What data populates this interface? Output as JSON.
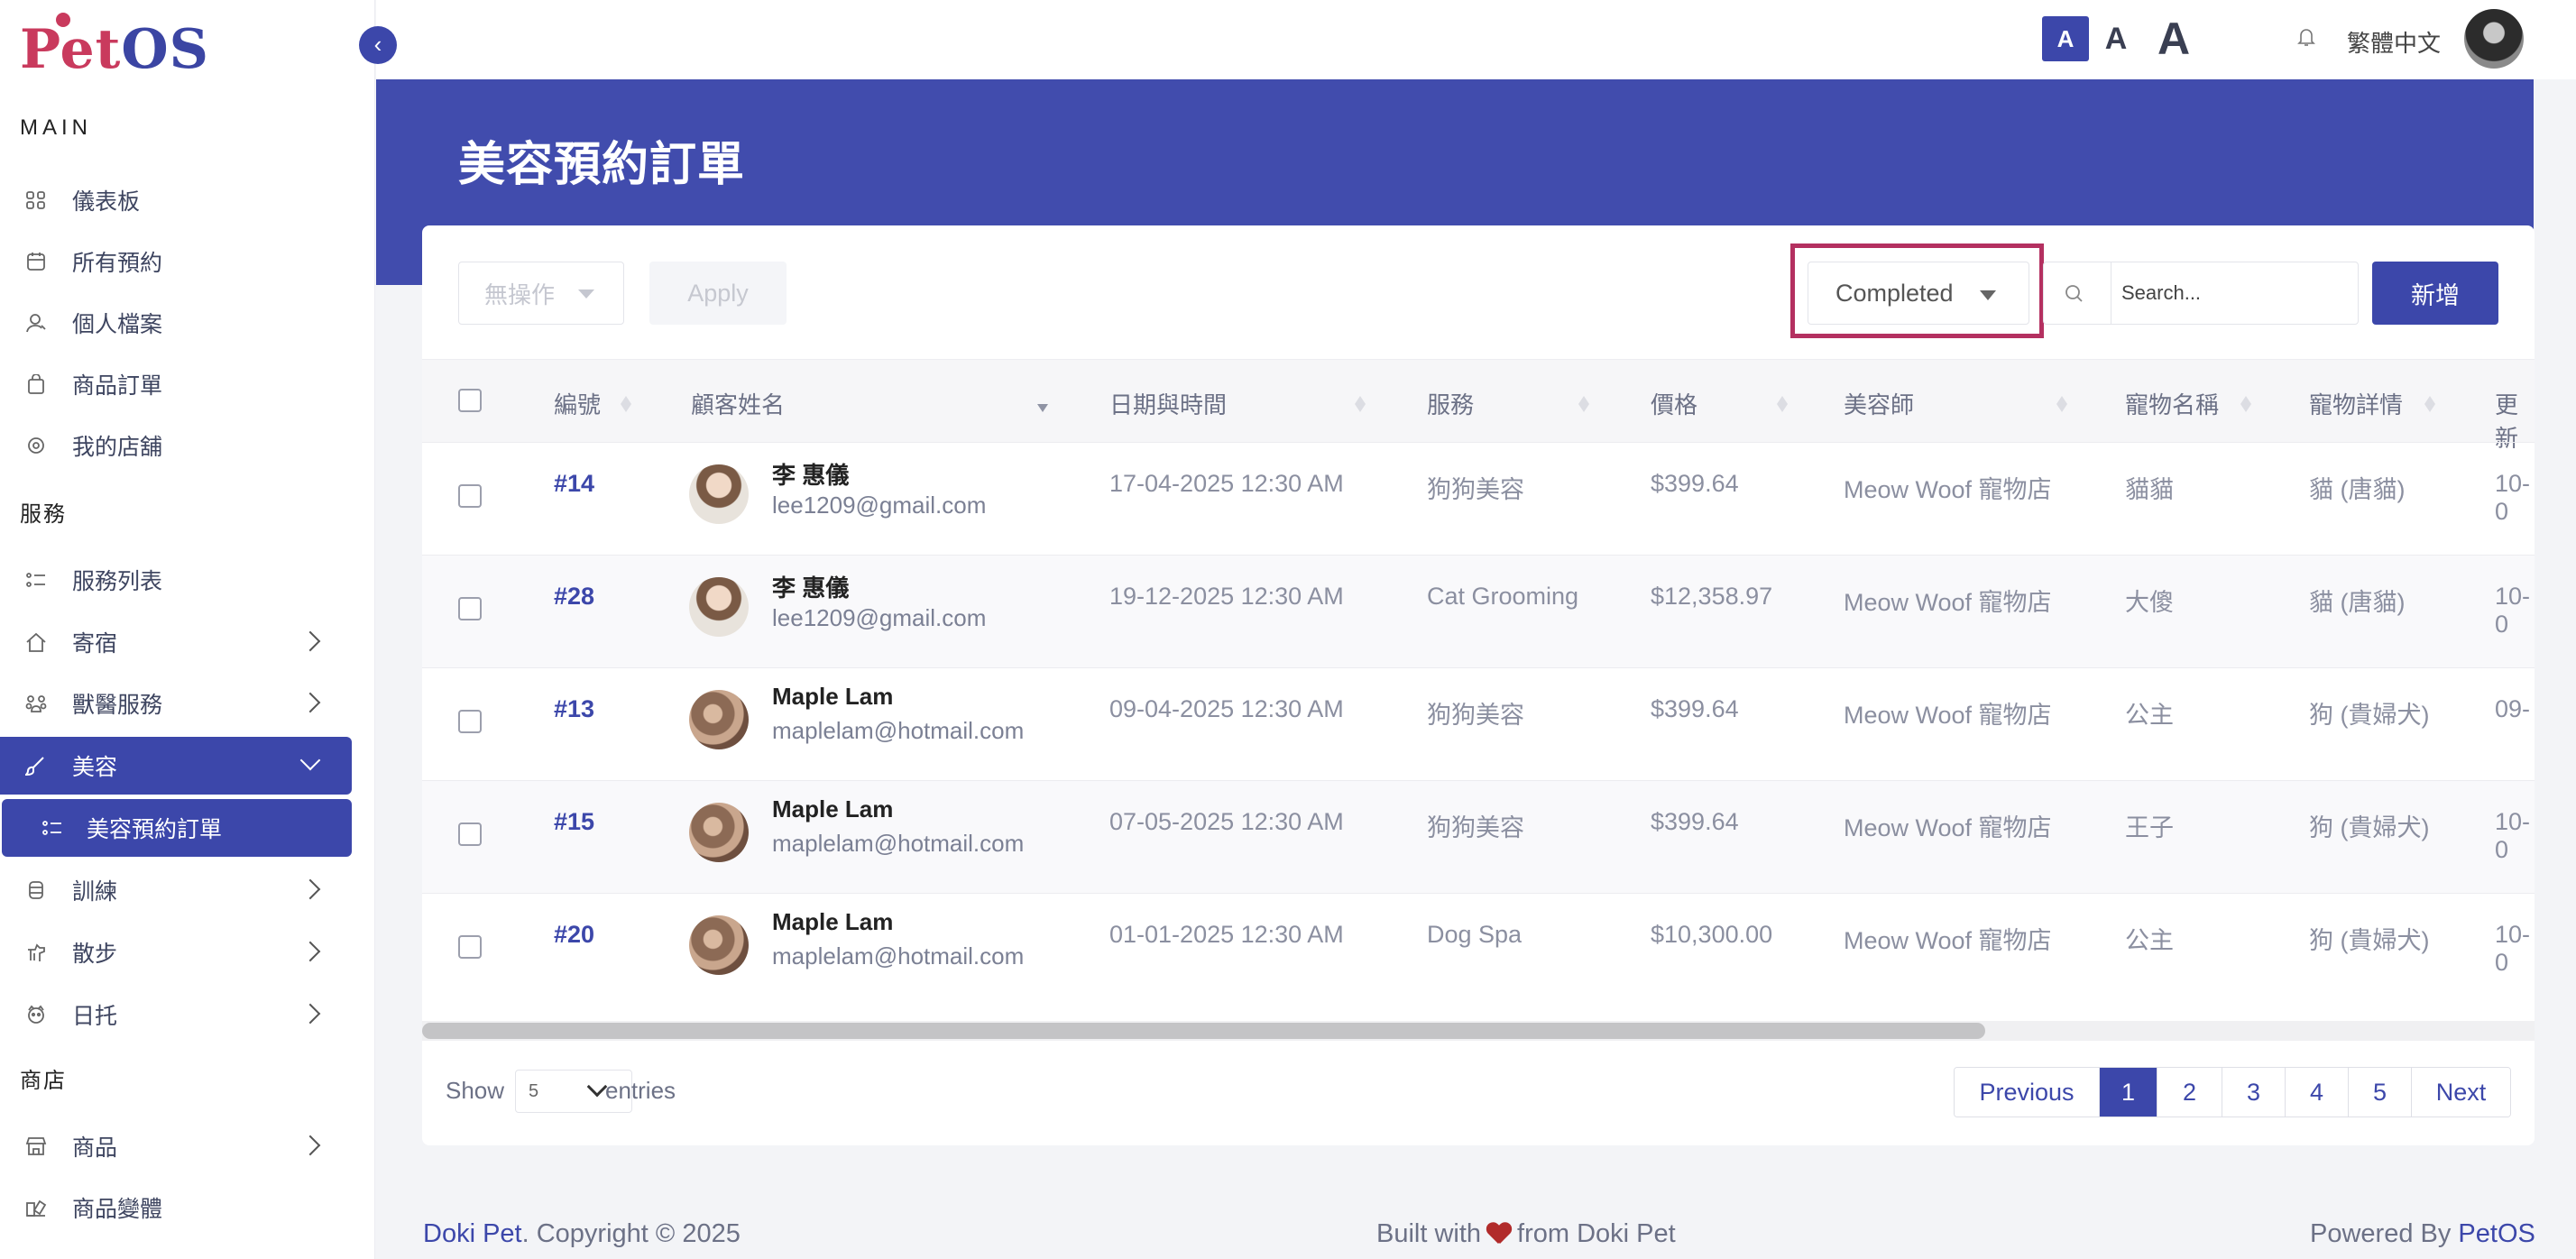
{
  "brand": {
    "logo_pet": "Pet",
    "logo_os": "OS"
  },
  "sidebar": {
    "main_title": "MAIN",
    "main_items": [
      {
        "label": "儀表板",
        "icon": "grid-icon"
      },
      {
        "label": "所有預約",
        "icon": "calendar-icon"
      },
      {
        "label": "個人檔案",
        "icon": "user-icon"
      },
      {
        "label": "商品訂單",
        "icon": "bag-icon"
      },
      {
        "label": "我的店舖",
        "icon": "shop-icon"
      }
    ],
    "service_title": "服務",
    "service_items": [
      {
        "label": "服務列表",
        "icon": "list-icon"
      },
      {
        "label": "寄宿",
        "icon": "home-icon"
      },
      {
        "label": "獸醫服務",
        "icon": "vet-icon"
      },
      {
        "label": "美容",
        "icon": "brush-icon"
      },
      {
        "label": "美容預約訂單",
        "icon": "list-icon"
      },
      {
        "label": "訓練",
        "icon": "training-icon"
      },
      {
        "label": "散步",
        "icon": "walk-icon"
      },
      {
        "label": "日托",
        "icon": "daycare-icon"
      }
    ],
    "shop_title": "商店",
    "shop_items": [
      {
        "label": "商品",
        "icon": "store-icon"
      },
      {
        "label": "商品變體",
        "icon": "variant-icon"
      }
    ]
  },
  "topbar": {
    "font_small": "A",
    "font_medium": "A",
    "font_large": "A",
    "language": "繁體中文"
  },
  "page": {
    "title": "美容預約訂單"
  },
  "toolbar": {
    "bulk_action": "無操作",
    "apply": "Apply",
    "status_filter": "Completed",
    "search_placeholder": "Search...",
    "add": "新增"
  },
  "table": {
    "headers": [
      "編號",
      "顧客姓名",
      "日期與時間",
      "服務",
      "價格",
      "美容師",
      "寵物名稱",
      "寵物詳情",
      "更新"
    ],
    "rows": [
      {
        "id": "#14",
        "name": "李 惠儀",
        "email": "lee1209@gmail.com",
        "datetime": "17-04-2025 12:30 AM",
        "service": "狗狗美容",
        "price": "$399.64",
        "groomer": "Meow Woof 寵物店",
        "pet": "貓貓",
        "detail": "貓 (唐貓)",
        "updated": "10-0"
      },
      {
        "id": "#28",
        "name": "李 惠儀",
        "email": "lee1209@gmail.com",
        "datetime": "19-12-2025 12:30 AM",
        "service": "Cat Grooming",
        "price": "$12,358.97",
        "groomer": "Meow Woof 寵物店",
        "pet": "大傻",
        "detail": "貓 (唐貓)",
        "updated": "10-0"
      },
      {
        "id": "#13",
        "name": "Maple Lam",
        "email": "maplelam@hotmail.com",
        "datetime": "09-04-2025 12:30 AM",
        "service": "狗狗美容",
        "price": "$399.64",
        "groomer": "Meow Woof 寵物店",
        "pet": "公主",
        "detail": "狗 (貴婦犬)",
        "updated": "09-"
      },
      {
        "id": "#15",
        "name": "Maple Lam",
        "email": "maplelam@hotmail.com",
        "datetime": "07-05-2025 12:30 AM",
        "service": "狗狗美容",
        "price": "$399.64",
        "groomer": "Meow Woof 寵物店",
        "pet": "王子",
        "detail": "狗 (貴婦犬)",
        "updated": "10-0"
      },
      {
        "id": "#20",
        "name": "Maple Lam",
        "email": "maplelam@hotmail.com",
        "datetime": "01-01-2025 12:30 AM",
        "service": "Dog Spa",
        "price": "$10,300.00",
        "groomer": "Meow Woof 寵物店",
        "pet": "公主",
        "detail": "狗 (貴婦犬)",
        "updated": "10-0"
      }
    ]
  },
  "pagination": {
    "show": "Show",
    "per_page": "5",
    "entries": "entries",
    "previous": "Previous",
    "pages": [
      "1",
      "2",
      "3",
      "4",
      "5"
    ],
    "current": "1",
    "next": "Next"
  },
  "footer": {
    "brand": "Doki Pet",
    "copyright": ". Copyright © 2025",
    "built_pre": "Built with",
    "built_post": "from Doki Pet",
    "powered": "Powered By",
    "powered_brand": "PetOS"
  },
  "colors": {
    "primary": "#3c47aa",
    "banner": "#414cad",
    "logo_red": "#c93a5d",
    "highlight": "#b43060"
  }
}
